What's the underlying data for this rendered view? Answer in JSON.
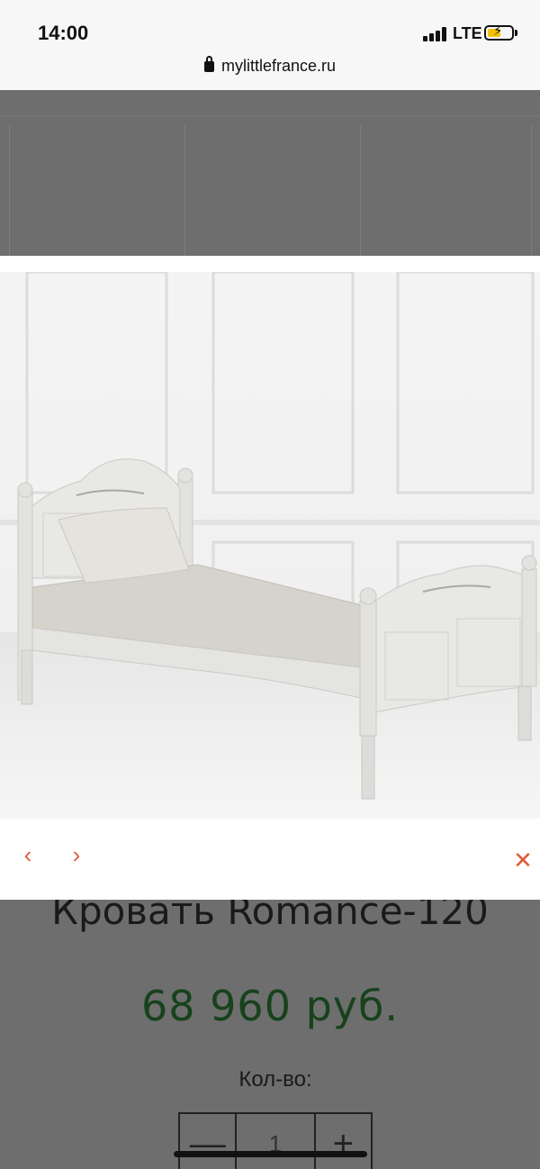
{
  "status_bar": {
    "time": "14:00",
    "network": "LTE",
    "battery_state": "charging",
    "url": "mylittlefrance.ru"
  },
  "lightbox": {
    "image_icon": "bed-photo",
    "prev_icon": "chevron-left-icon",
    "next_icon": "chevron-right-icon",
    "close_icon": "close-icon",
    "prev_glyph": "‹",
    "next_glyph": "›",
    "close_glyph": "✕",
    "accent_color": "#e05a3a"
  },
  "product": {
    "title": "Кровать Romance-120",
    "price": "68 960 руб.",
    "price_color": "#17421c",
    "quantity_label": "Кол-во:",
    "quantity_value": "1",
    "minus_glyph": "—",
    "plus_glyph": "+"
  }
}
